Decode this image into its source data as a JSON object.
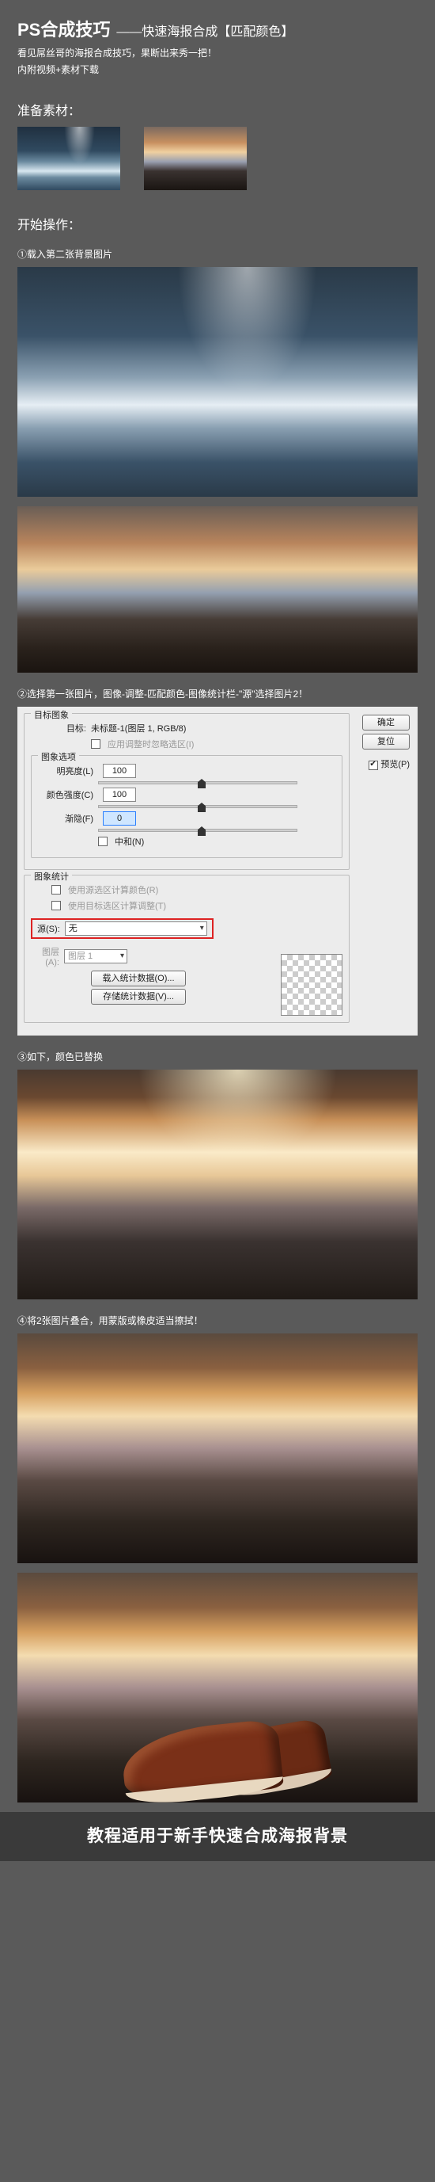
{
  "header": {
    "title_main": "PS合成技巧",
    "title_sub": "——快速海报合成【匹配颜色】",
    "intro": "看见屌丝哥的海报合成技巧，果断出来秀一把！",
    "subnote": "内附视频+素材下载"
  },
  "sections": {
    "prepare": "准备素材：",
    "start": "开始操作："
  },
  "steps": {
    "s1": "①载入第二张背景图片",
    "s2": "②选择第一张图片，图像-调整-匹配颜色-图像统计栏-\"源\"选择图片2！",
    "s3": "③如下，颜色已替换",
    "s4": "④将2张图片叠合，用蒙版或橡皮适当擦拭！"
  },
  "dialog": {
    "target_group": "目标图象",
    "target_label": "目标:",
    "target_value": "未标题-1(图层 1, RGB/8)",
    "apply_adj": "应用调整时忽略选区(I)",
    "options_group": "图象选项",
    "luminance": "明亮度(L)",
    "color_intensity": "颜色强度(C)",
    "fade": "渐隐(F)",
    "neutralize": "中和(N)",
    "val_lum": "100",
    "val_col": "100",
    "val_fade": "0",
    "stats_group": "图象统计",
    "use_sel_src": "使用源选区计算颜色(R)",
    "use_sel_tgt": "使用目标选区计算调整(T)",
    "source_label": "源(S):",
    "source_value": "无",
    "layer_label": "图层(A):",
    "layer_value": "图层 1",
    "load_stats": "载入统计数据(O)...",
    "save_stats": "存储统计数据(V)...",
    "ok": "确定",
    "cancel": "复位",
    "preview": "预览(P)"
  },
  "footer": "教程适用于新手快速合成海报背景"
}
